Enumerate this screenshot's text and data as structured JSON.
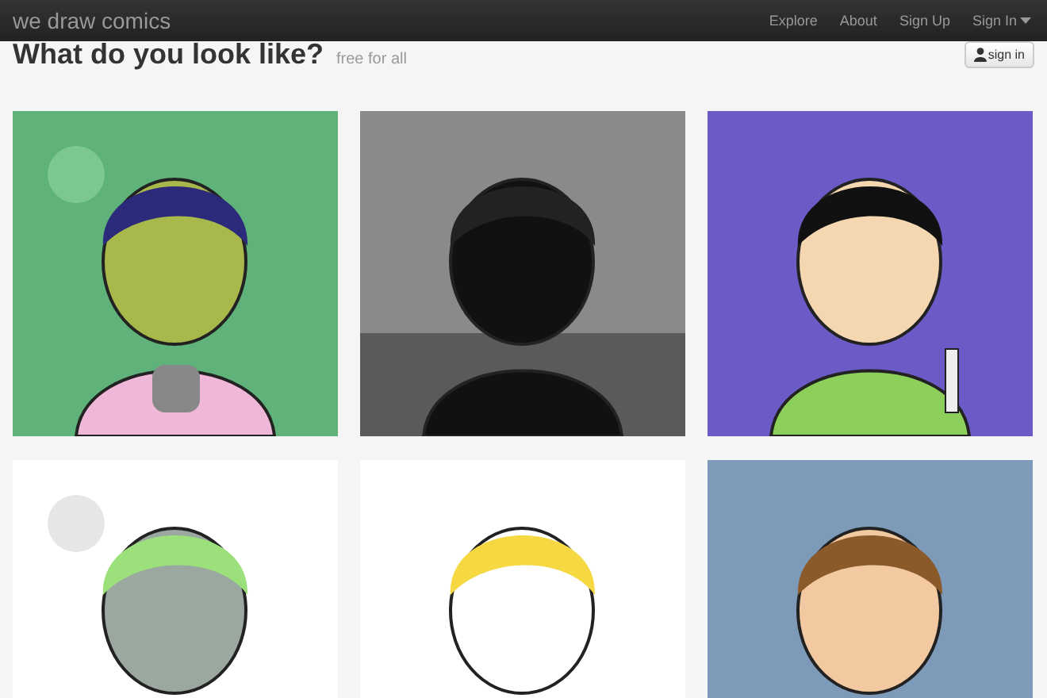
{
  "navbar": {
    "brand": "we draw comics",
    "links": [
      {
        "label": "Explore",
        "kind": "link"
      },
      {
        "label": "About",
        "kind": "link"
      },
      {
        "label": "Sign Up",
        "kind": "link"
      },
      {
        "label": "Sign In",
        "kind": "dropdown"
      }
    ]
  },
  "heading": {
    "title": "What do you look like?",
    "subtitle": "free for all"
  },
  "sign_in_button": "sign in"
}
